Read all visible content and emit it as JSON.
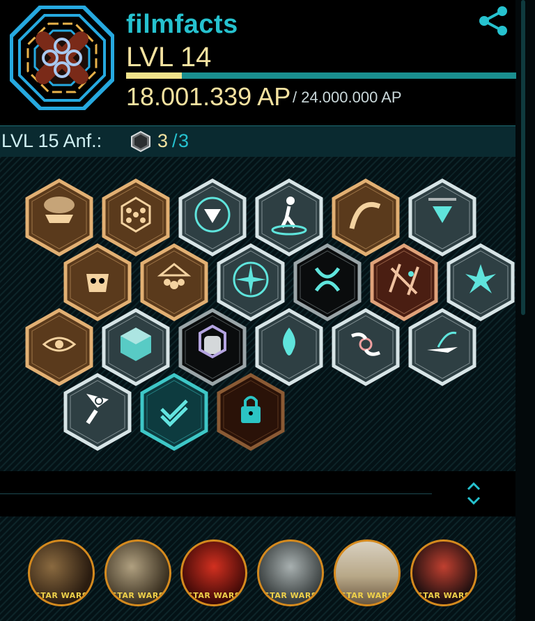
{
  "profile": {
    "agent_name": "filmfacts",
    "level": "LVL 14",
    "ap_current": "18.001.339 AP",
    "ap_total": "/ 24.000.000 AP",
    "ap_progress": 0.143
  },
  "requirements": {
    "label": "LVL 15 Anf.:",
    "current": "3",
    "separator": "/",
    "required": "3"
  },
  "badges": [
    {
      "id": "badge-airship",
      "icon": "airship-icon",
      "tier": "bronze"
    },
    {
      "id": "badge-network",
      "icon": "network-grid-icon",
      "tier": "bronze"
    },
    {
      "id": "badge-resonator",
      "icon": "resonator-down-icon",
      "tier": "silver"
    },
    {
      "id": "badge-explorer",
      "icon": "walking-agent-icon",
      "tier": "silver"
    },
    {
      "id": "badge-arch",
      "icon": "arch-icon",
      "tier": "bronze"
    },
    {
      "id": "badge-deploy",
      "icon": "deploy-arrow-icon",
      "tier": "silver"
    },
    {
      "id": "badge-mask",
      "icon": "mask-icon",
      "tier": "bronze"
    },
    {
      "id": "badge-group",
      "icon": "group-people-icon",
      "tier": "bronze"
    },
    {
      "id": "badge-compass",
      "icon": "compass-icon",
      "tier": "silver"
    },
    {
      "id": "badge-vortex",
      "icon": "vortex-icon",
      "tier": "black"
    },
    {
      "id": "badge-map",
      "icon": "map-path-icon",
      "tier": "brown"
    },
    {
      "id": "badge-shatter",
      "icon": "shatter-icon",
      "tier": "silver"
    },
    {
      "id": "badge-eye",
      "icon": "eye-icon",
      "tier": "bronze"
    },
    {
      "id": "badge-cube",
      "icon": "cube-icon",
      "tier": "silver"
    },
    {
      "id": "badge-fist",
      "icon": "fist-icon",
      "tier": "black"
    },
    {
      "id": "badge-flame",
      "icon": "flame-icon",
      "tier": "silver"
    },
    {
      "id": "badge-hands",
      "icon": "hands-virus-icon",
      "tier": "silver"
    },
    {
      "id": "badge-glider",
      "icon": "glider-icon",
      "tier": "silver"
    },
    {
      "id": "badge-flag",
      "icon": "flag-hand-icon",
      "tier": "silver"
    },
    {
      "id": "badge-check",
      "icon": "checkmark-icon",
      "tier": "teal"
    },
    {
      "id": "badge-lock",
      "icon": "lock-icon",
      "tier": "dark-bronze"
    }
  ],
  "media": [
    {
      "id": "media-1",
      "logo": "STAR WARS",
      "scene": "chewbacca-han"
    },
    {
      "id": "media-2",
      "logo": "STAR WARS",
      "scene": "phasma-troopers"
    },
    {
      "id": "media-3",
      "logo": "STAR WARS",
      "scene": "red-hangar"
    },
    {
      "id": "media-4",
      "logo": "STAR WARS",
      "scene": "rey-goggles"
    },
    {
      "id": "media-5",
      "logo": "STAR WARS",
      "scene": "desert-destroyer"
    },
    {
      "id": "media-6",
      "logo": "STAR WARS",
      "scene": "poster"
    }
  ],
  "colors": {
    "accent_teal": "#26c2cf",
    "gold_text": "#f5e2a0",
    "medal_ring": "#d58a1e",
    "background": "#03090b"
  }
}
